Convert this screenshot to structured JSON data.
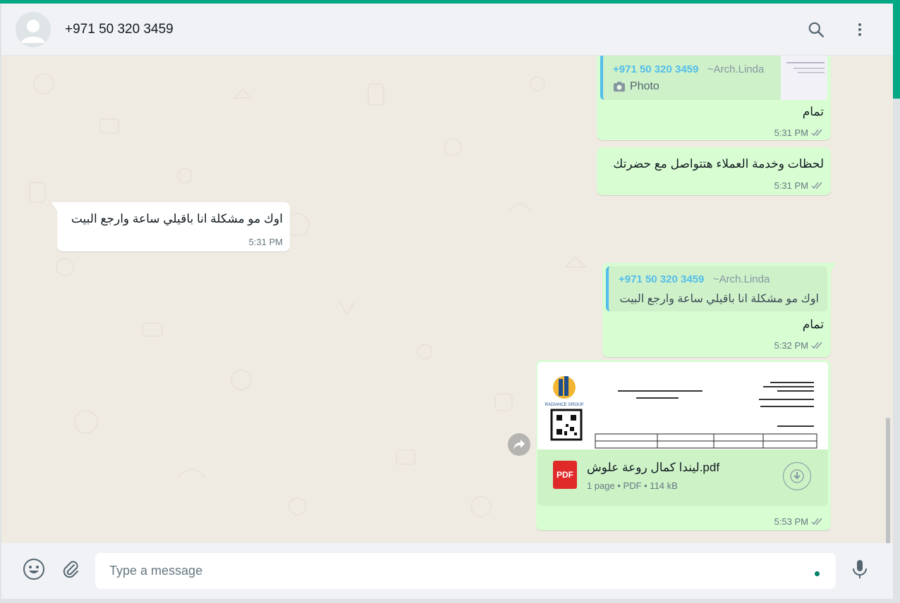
{
  "header": {
    "contact_name": "+971 50 320 3459",
    "icons": [
      "default-avatar",
      "search-icon",
      "menu-icon"
    ]
  },
  "messages": [
    {
      "direction": "outgoing",
      "quote": {
        "phone": "+971 50 320 3459",
        "alias": "~Arch.Linda",
        "text": "Photo",
        "icon": "camera-icon"
      },
      "text": "تمام",
      "time": "5:31 PM",
      "status": "read-double-tick"
    },
    {
      "direction": "outgoing",
      "text": "لحظات وخدمة العملاء هتتواصل مع حضرتك",
      "time": "5:31 PM",
      "status": "read-double-tick"
    },
    {
      "direction": "incoming",
      "text": "اوك مو مشكلة انا باقيلي ساعة وارجع البيت",
      "time": "5:31 PM"
    },
    {
      "direction": "outgoing",
      "quote": {
        "phone": "+971 50 320 3459",
        "alias": "~Arch.Linda",
        "text": "اوك مو مشكلة انا باقيلي ساعة وارجع البيت"
      },
      "text": "تمام",
      "time": "5:32 PM",
      "status": "read-double-tick"
    },
    {
      "direction": "outgoing",
      "document": {
        "file_name": "ليندا كمال روعة علوش.pdf",
        "details": "1 page • PDF • 114 kB",
        "type_badge": "PDF",
        "preview_logo_text": "RADIANCE GROUP"
      },
      "time": "5:53 PM",
      "status": "read-double-tick"
    }
  ],
  "footer": {
    "placeholder": "Type a message",
    "icons": [
      "emoji-icon",
      "attach-icon",
      "mic-icon"
    ]
  },
  "colors": {
    "accent": "#00a884",
    "outgoing_bubble": "#d9fdd3",
    "incoming_bubble": "#ffffff",
    "chat_background": "#efeae2",
    "quote_bar": "#53bdeb"
  }
}
